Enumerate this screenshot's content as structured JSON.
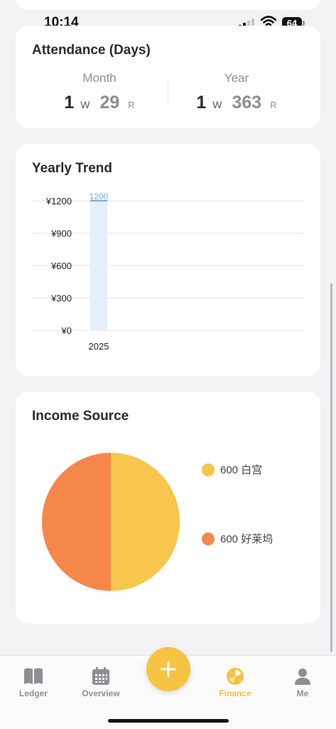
{
  "status_bar": {
    "time": "10:14",
    "battery": "64"
  },
  "attendance": {
    "title": "Attendance (Days)",
    "month": {
      "label": "Month",
      "work": "1",
      "work_unit": "W",
      "rest": "29",
      "rest_unit": "R"
    },
    "year": {
      "label": "Year",
      "work": "1",
      "work_unit": "W",
      "rest": "363",
      "rest_unit": "R"
    }
  },
  "yearly_trend": {
    "title": "Yearly Trend"
  },
  "income_source": {
    "title": "Income Source",
    "legend": [
      {
        "label": "600 白宫",
        "color": "#f8c54d"
      },
      {
        "label": "600 好莱坞",
        "color": "#f6874a"
      }
    ]
  },
  "chart_data": [
    {
      "type": "bar",
      "categories": [
        "2025"
      ],
      "values": [
        1200
      ],
      "data_labels": [
        "1200"
      ],
      "yticks": [
        "¥0",
        "¥300",
        "¥600",
        "¥900",
        "¥1200"
      ],
      "ylim": [
        0,
        1200
      ],
      "grid": true,
      "bar_color": "#e6eefc",
      "label_color": "#7aa7d8"
    },
    {
      "type": "pie",
      "labels": [
        "白宫",
        "好莱坞"
      ],
      "values": [
        600,
        600
      ],
      "colors": [
        "#f8c54d",
        "#f6874a"
      ]
    }
  ],
  "tab_bar": {
    "tabs": [
      {
        "label": "Ledger",
        "icon": "book-icon"
      },
      {
        "label": "Overview",
        "icon": "calendar-icon"
      },
      {
        "label": "Finance",
        "icon": "pie-chart-icon",
        "active": true
      },
      {
        "label": "Me",
        "icon": "person-icon"
      }
    ],
    "accent": "#f6c142"
  }
}
